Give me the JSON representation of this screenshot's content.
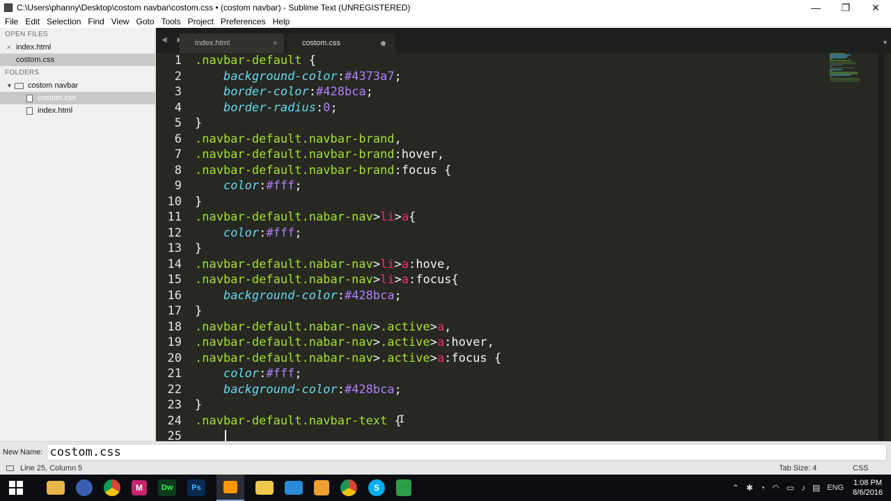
{
  "window": {
    "title": "C:\\Users\\phanny\\Desktop\\costom navbar\\costom.css • (costom navbar) - Sublime Text (UNREGISTERED)",
    "minimize": "—",
    "maximize": "❐",
    "close": "✕"
  },
  "menu": [
    "File",
    "Edit",
    "Selection",
    "Find",
    "View",
    "Goto",
    "Tools",
    "Project",
    "Preferences",
    "Help"
  ],
  "sidebar": {
    "open_files_header": "OPEN FILES",
    "open_files": [
      {
        "label": "index.html",
        "active": false
      },
      {
        "label": "costom.css",
        "active": true
      }
    ],
    "folders_header": "FOLDERS",
    "folder": "costom navbar",
    "folder_files": [
      {
        "label": "costom.css",
        "active": true
      },
      {
        "label": "index.html",
        "active": false
      }
    ]
  },
  "tabs": [
    {
      "label": "index.html",
      "close": "×"
    },
    {
      "label": "costom.css",
      "modified": true
    }
  ],
  "tab_nav": "◀ ▶",
  "tab_dropdown": "▼",
  "line_numbers": [
    "1",
    "2",
    "3",
    "4",
    "5",
    "6",
    "7",
    "8",
    "9",
    "10",
    "11",
    "12",
    "13",
    "14",
    "15",
    "16",
    "17",
    "18",
    "19",
    "20",
    "21",
    "22",
    "23",
    "24",
    "25"
  ],
  "code": {
    "l1": ".navbar-default",
    "l2p": "background-color",
    "l2v": "#4373a7",
    "l3p": "border-color",
    "l3v": "#428bca",
    "l4p": "border-radius",
    "l4v": "0",
    "l6": ".navbar-default.navbar-brand",
    "l7a": ".navbar-default.navbar-brand",
    "l7b": "hover",
    "l8a": ".navbar-default.navbar-brand",
    "l8b": "focus",
    "l9p": "color",
    "l9v": "#fff",
    "l11": ".navbar-default.nabar-nav",
    "l12p": "color",
    "l12v": "#fff",
    "l14a": ".navbar-default.nabar-nav",
    "l14b": "hove",
    "l15a": ".navbar-default.nabar-nav",
    "l15b": "focus",
    "l16p": "background-color",
    "l16v": "#428bca",
    "l18": ".navbar-default.nabar-nav",
    "l19b": "hover",
    "l20b": "focus",
    "l21p": "color",
    "l21v": "#fff",
    "l22p": "background-color",
    "l22v": "#428bca",
    "l24": ".navbar-default.navbar-text",
    "li": "li",
    "a": "a",
    "active": ".active"
  },
  "name_panel": {
    "label": "New Name:",
    "value": "costom.css"
  },
  "status": {
    "position": "Line 25, Column 5",
    "tab_size": "Tab Size: 4",
    "syntax": "CSS"
  },
  "taskbar": {
    "apps": [
      "file-explorer",
      "paint",
      "chrome",
      "m-app",
      "dreamweaver",
      "photoshop",
      "sublime-text",
      "folder",
      "window-app",
      "media-player",
      "chrome",
      "skype",
      "notepad"
    ],
    "tray_lang": "ENG",
    "time": "1:08 PM",
    "date": "8/6/2016"
  },
  "colors": {
    "selector": "#a6e22e",
    "property": "#66d9ef",
    "value": "#ae81ff",
    "tag": "#f92672",
    "editor_bg": "#272822"
  }
}
